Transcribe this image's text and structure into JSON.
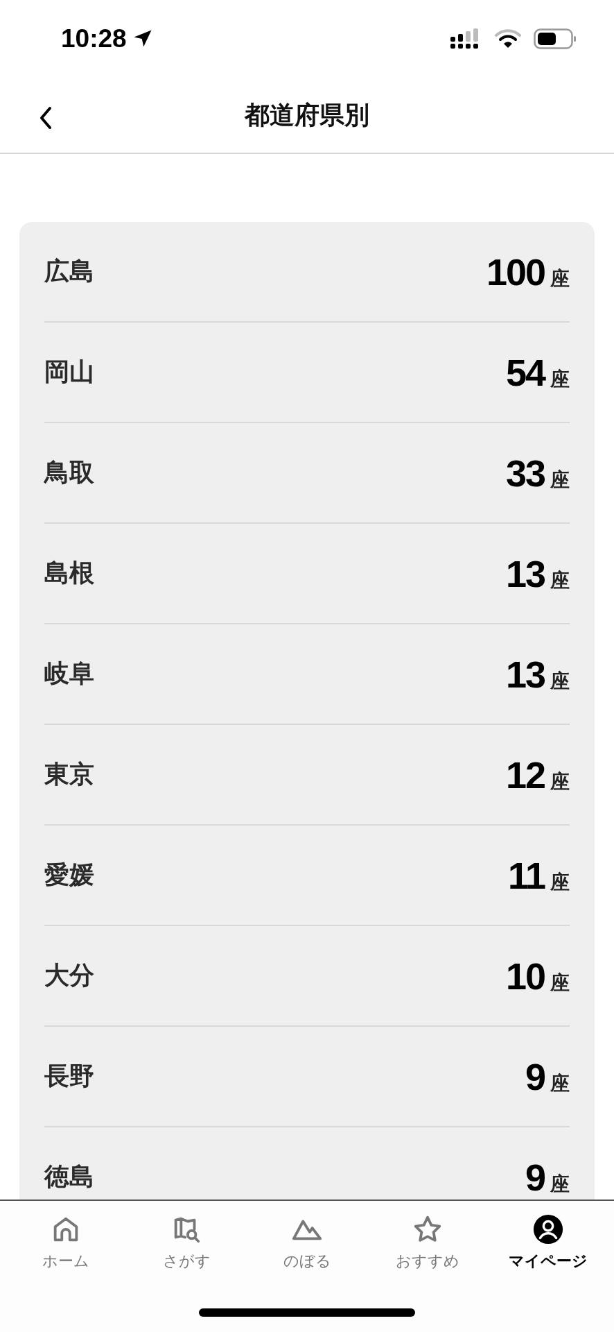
{
  "status_bar": {
    "time": "10:28"
  },
  "header": {
    "title": "都道府県別"
  },
  "prefectures": [
    {
      "name": "広島",
      "count": "100",
      "unit": "座"
    },
    {
      "name": "岡山",
      "count": "54",
      "unit": "座"
    },
    {
      "name": "鳥取",
      "count": "33",
      "unit": "座"
    },
    {
      "name": "島根",
      "count": "13",
      "unit": "座"
    },
    {
      "name": "岐阜",
      "count": "13",
      "unit": "座"
    },
    {
      "name": "東京",
      "count": "12",
      "unit": "座"
    },
    {
      "name": "愛媛",
      "count": "11",
      "unit": "座"
    },
    {
      "name": "大分",
      "count": "10",
      "unit": "座"
    },
    {
      "name": "長野",
      "count": "9",
      "unit": "座"
    },
    {
      "name": "徳島",
      "count": "9",
      "unit": "座"
    }
  ],
  "tab_bar": [
    {
      "kind": "home",
      "label": "ホーム",
      "selected": false
    },
    {
      "kind": "search",
      "label": "さがす",
      "selected": false
    },
    {
      "kind": "climb",
      "label": "のぼる",
      "selected": false
    },
    {
      "kind": "recommend",
      "label": "おすすめ",
      "selected": false
    },
    {
      "kind": "mypage",
      "label": "マイページ",
      "selected": true
    }
  ]
}
